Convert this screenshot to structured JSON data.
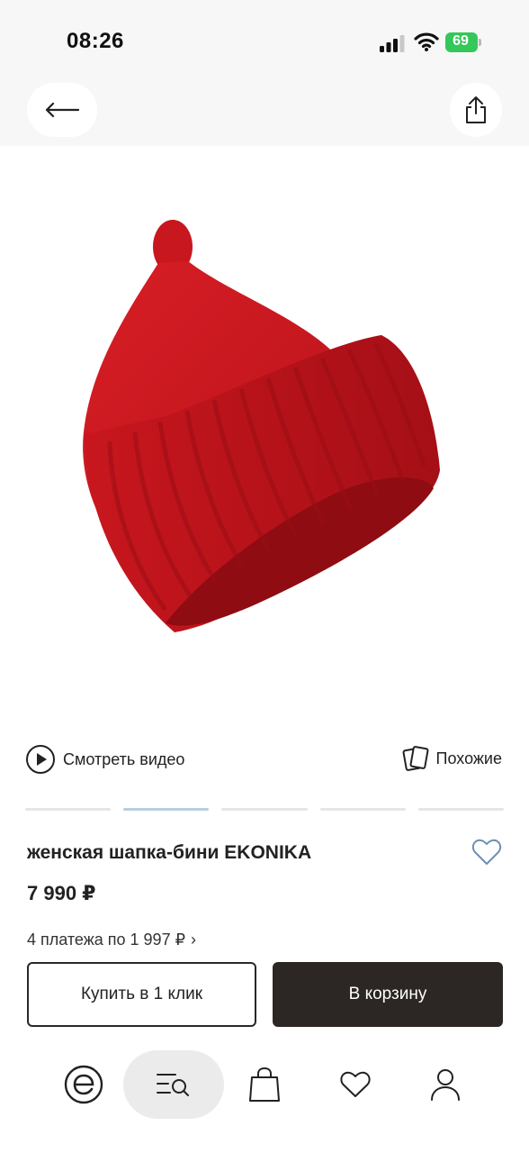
{
  "status_bar": {
    "time": "08:26",
    "battery": "69"
  },
  "product": {
    "title": "женская шапка-бини EKONIKA",
    "price": "7 990 ₽",
    "installments": "4 платежа по 1 997 ₽",
    "image": {
      "subject": "red-knit-beanie",
      "color": "#c4161c"
    }
  },
  "media": {
    "video_label": "Смотреть видео",
    "similar_label": "Похожие"
  },
  "gallery": {
    "pages": 5,
    "active": 2
  },
  "actions": {
    "buy_one_click": "Купить в 1 клик",
    "add_to_cart": "В корзину"
  },
  "tabs": [
    {
      "id": "home",
      "icon": "brand-e-icon"
    },
    {
      "id": "catalog",
      "icon": "catalog-search-icon",
      "active": true
    },
    {
      "id": "bag",
      "icon": "shopping-bag-icon"
    },
    {
      "id": "favorites",
      "icon": "heart-icon"
    },
    {
      "id": "profile",
      "icon": "user-icon"
    }
  ],
  "colors": {
    "primary": "#2c2724",
    "accent_heart": "#6b8fb5",
    "pager_active": "#b9cfe0",
    "battery": "#34c759"
  }
}
